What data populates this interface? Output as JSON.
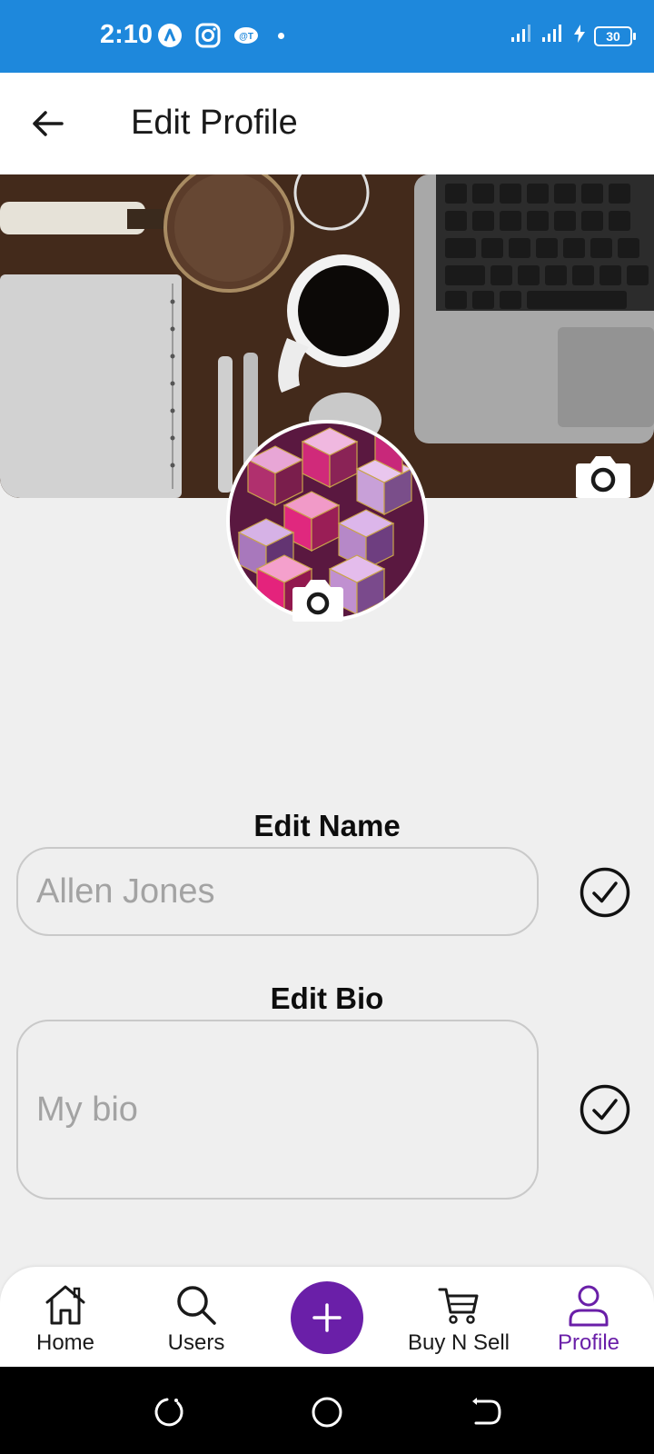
{
  "status_bar": {
    "time": "2:10",
    "battery": "30",
    "left_icons": [
      "app-a-icon",
      "instagram-icon",
      "chat-icon",
      "notification-dot"
    ],
    "right_icons": [
      "signal-icon",
      "signal-icon",
      "charging-icon",
      "battery-icon"
    ]
  },
  "app_bar": {
    "title": "Edit Profile",
    "back_icon": "arrow-left-icon"
  },
  "profile": {
    "cover_icon": "camera-icon",
    "avatar_icon": "camera-icon"
  },
  "form": {
    "name_label": "Edit Name",
    "name_placeholder": "Allen Jones",
    "bio_label": "Edit Bio",
    "bio_placeholder": "My bio",
    "confirm_icon": "check-circle-icon"
  },
  "bottom_nav": {
    "items": [
      {
        "label": "Home",
        "icon": "home-icon"
      },
      {
        "label": "Users",
        "icon": "search-icon"
      },
      {
        "label": "",
        "icon": "plus-icon"
      },
      {
        "label": "Buy N Sell",
        "icon": "cart-icon"
      },
      {
        "label": "Profile",
        "icon": "user-icon"
      }
    ],
    "active": "Profile",
    "accent": "#6a1fa8"
  },
  "colors": {
    "status_bar": "#1e88dc",
    "background": "#efefef",
    "accent": "#6a1fa8"
  }
}
